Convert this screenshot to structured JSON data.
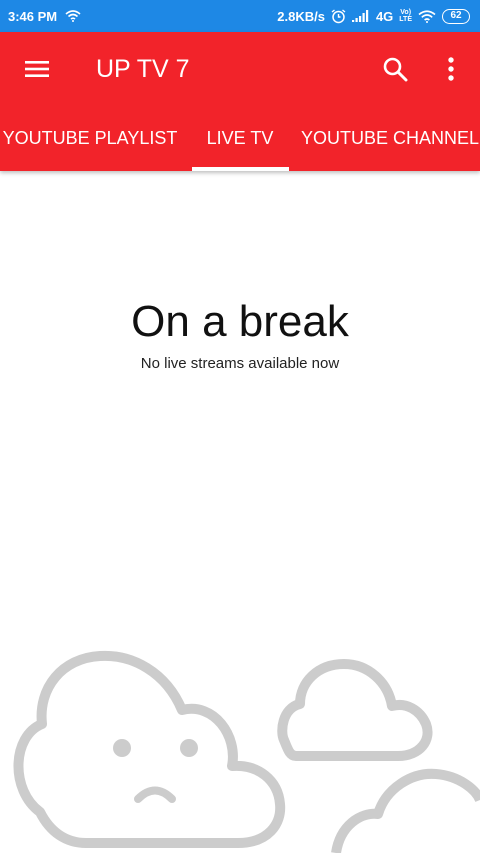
{
  "status_bar": {
    "time": "3:46 PM",
    "net_speed": "2.8KB/s",
    "network_type": "4G",
    "volte_top": "Vo)",
    "volte_bottom": "LTE",
    "battery_level": "62",
    "icons": [
      "wifi-icon",
      "alarm-icon",
      "signal-icon",
      "wifi-icon",
      "battery-icon"
    ]
  },
  "app_bar": {
    "title": "UP TV 7",
    "background_color": "#f2232a",
    "icons": [
      "menu-icon",
      "search-icon",
      "more-vertical-icon"
    ]
  },
  "tabs": [
    {
      "label": "YOUTUBE PLAYLIST",
      "selected": false
    },
    {
      "label": "LIVE TV",
      "selected": true
    },
    {
      "label": "YOUTUBE CHANNEL",
      "selected": false
    }
  ],
  "empty_state": {
    "title": "On a break",
    "subtitle": "No live streams available now",
    "illustration": "sad-cloud-icon"
  }
}
